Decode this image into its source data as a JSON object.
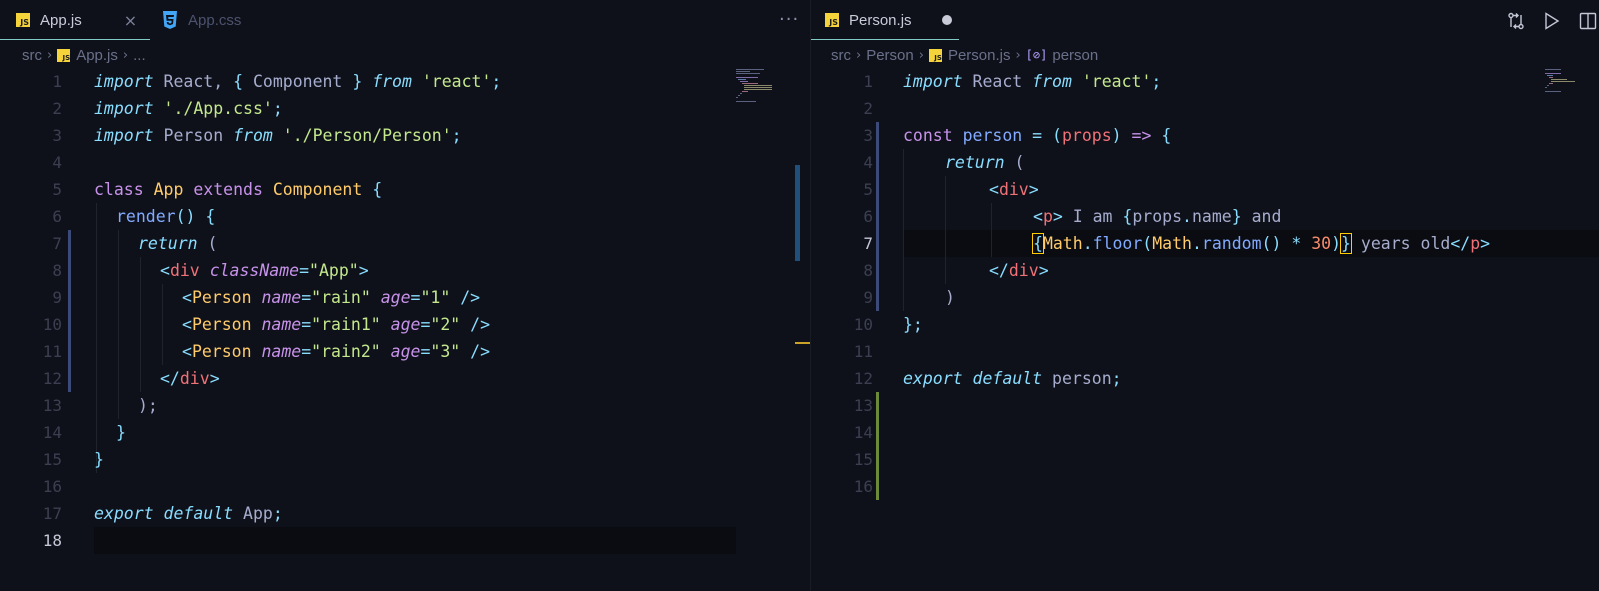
{
  "left": {
    "tabs": [
      {
        "label": "App.js",
        "icon": "js-file-icon",
        "active": true,
        "close": "×"
      },
      {
        "label": "App.css",
        "icon": "css-file-icon",
        "active": false
      }
    ],
    "more_label": "···",
    "breadcrumbs": {
      "folder": "src",
      "file": "App.js",
      "more": "..."
    },
    "current_line": 18,
    "lines": [
      {
        "n": "1"
      },
      {
        "n": "2"
      },
      {
        "n": "3"
      },
      {
        "n": "4"
      },
      {
        "n": "5"
      },
      {
        "n": "6"
      },
      {
        "n": "7"
      },
      {
        "n": "8"
      },
      {
        "n": "9"
      },
      {
        "n": "10"
      },
      {
        "n": "11"
      },
      {
        "n": "12"
      },
      {
        "n": "13"
      },
      {
        "n": "14"
      },
      {
        "n": "15"
      },
      {
        "n": "16"
      },
      {
        "n": "17"
      },
      {
        "n": "18"
      }
    ],
    "code": {
      "l1": [
        "import",
        " React, ",
        "{",
        " Component ",
        "}",
        " ",
        "from",
        " ",
        "'react'",
        ";"
      ],
      "l2": [
        "import",
        " ",
        "'./App.css'",
        ";"
      ],
      "l3": [
        "import",
        " Person ",
        "from",
        " ",
        "'./Person/Person'",
        ";"
      ],
      "l5": [
        "class",
        " ",
        "App",
        " ",
        "extends",
        " ",
        "Component",
        " ",
        "{"
      ],
      "l6": [
        "render",
        "()",
        " ",
        "{"
      ],
      "l7": [
        "return",
        " ("
      ],
      "l8": [
        "<",
        "div",
        " ",
        "className",
        "=",
        "\"App\"",
        ">"
      ],
      "l9": [
        "<",
        "Person",
        " ",
        "name",
        "=",
        "\"rain\"",
        " ",
        "age",
        "=",
        "\"1\"",
        " ",
        "/>"
      ],
      "l10": [
        "<",
        "Person",
        " ",
        "name",
        "=",
        "\"rain1\"",
        " ",
        "age",
        "=",
        "\"2\"",
        " ",
        "/>"
      ],
      "l11": [
        "<",
        "Person",
        " ",
        "name",
        "=",
        "\"rain2\"",
        " ",
        "age",
        "=",
        "\"3\"",
        " ",
        "/>"
      ],
      "l12": [
        "</",
        "div",
        ">"
      ],
      "l13": [
        ");"
      ],
      "l14": [
        "}"
      ],
      "l15": [
        "}"
      ],
      "l17": [
        "export",
        " ",
        "default",
        " App",
        ";"
      ]
    }
  },
  "right": {
    "tabs": [
      {
        "label": "Person.js",
        "icon": "js-file-icon",
        "active": true,
        "dirty": true
      }
    ],
    "breadcrumbs": {
      "folder1": "src",
      "folder2": "Person",
      "file": "Person.js",
      "symbol_icon": "[⊘]",
      "symbol": "person"
    },
    "current_line": 7,
    "lines": [
      {
        "n": "1"
      },
      {
        "n": "2"
      },
      {
        "n": "3"
      },
      {
        "n": "4"
      },
      {
        "n": "5"
      },
      {
        "n": "6"
      },
      {
        "n": "7"
      },
      {
        "n": "8"
      },
      {
        "n": "9"
      },
      {
        "n": "10"
      },
      {
        "n": "11"
      },
      {
        "n": "12"
      },
      {
        "n": "13"
      },
      {
        "n": "14"
      },
      {
        "n": "15"
      },
      {
        "n": "16"
      }
    ],
    "code": {
      "l1": [
        "import",
        " React ",
        "from",
        " ",
        "'react'",
        ";"
      ],
      "l3": [
        "const",
        " ",
        "person",
        " ",
        "=",
        " ",
        "(",
        "props",
        ")",
        " ",
        "=>",
        " ",
        "{"
      ],
      "l4": [
        "return",
        " ("
      ],
      "l5": [
        "<",
        "div",
        ">"
      ],
      "l6": [
        "<",
        "p",
        ">",
        " I am ",
        "{",
        "props",
        ".",
        "name",
        "}",
        " and"
      ],
      "l7": [
        "{",
        "Math",
        ".",
        "floor",
        "(",
        "Math",
        ".",
        "random",
        "()",
        " ",
        "*",
        " ",
        "30",
        ")",
        "}",
        " years old",
        "</",
        "p",
        ">"
      ],
      "l8": [
        "</",
        "div",
        ">"
      ],
      "l9": [
        ")"
      ],
      "l10": [
        "};"
      ],
      "l12": [
        "export",
        " ",
        "default",
        " person",
        ";"
      ]
    }
  },
  "colors": {
    "background": "#0f111a",
    "keyword": "#c792ea",
    "string": "#c3e88d",
    "tag": "#f07178",
    "function": "#82aaff",
    "class": "#ffcb6b",
    "punctuation": "#89ddff",
    "number": "#f78c6c"
  },
  "icons": {
    "source_control": "compare-changes-icon",
    "run": "play-icon",
    "split": "split-editor-icon"
  }
}
